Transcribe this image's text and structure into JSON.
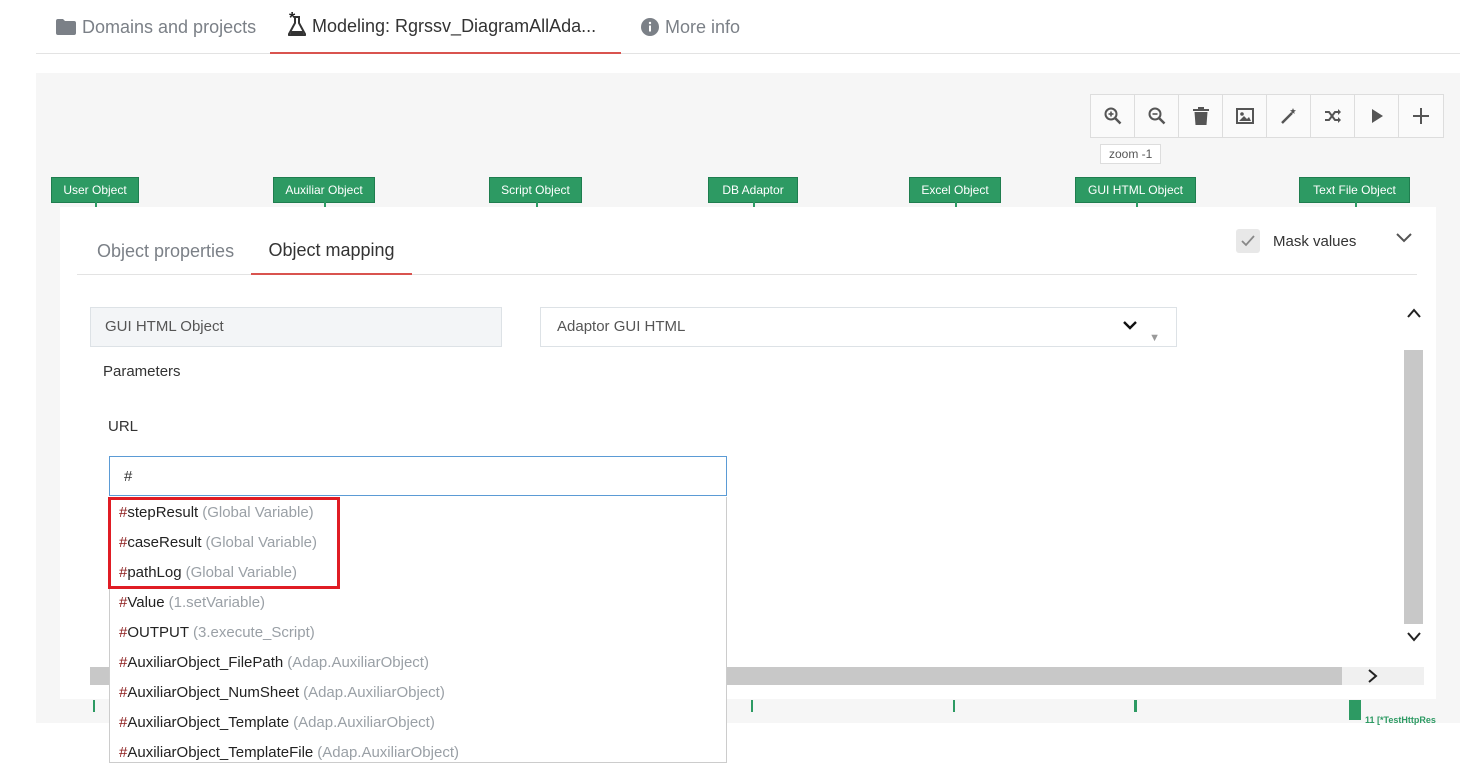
{
  "top_tabs": {
    "domains": "Domains and projects",
    "modeling_marker": "*",
    "modeling": "Modeling: Rgrssv_DiagramAllAda...",
    "more_info": "More info"
  },
  "toolbar": {
    "zoom_label": "zoom -1",
    "icons": [
      "zoom-in-icon",
      "zoom-out-icon",
      "trash-icon",
      "image-icon",
      "magic-wand-icon",
      "shuffle-icon",
      "play-icon",
      "plus-icon"
    ]
  },
  "nodes": [
    "User Object",
    "Auxiliar Object",
    "Script Object",
    "DB Adaptor",
    "Excel Object",
    "GUI HTML Object",
    "Text File Object"
  ],
  "panel": {
    "tab_properties": "Object properties",
    "tab_mapping": "Object mapping",
    "mask_values": "Mask values",
    "object_name": "GUI HTML Object",
    "adaptor": "Adaptor GUI HTML",
    "parameters": "Parameters",
    "url_label": "URL",
    "url_value": "#"
  },
  "bottom_text": "11 [*TestHttpRes",
  "autocomplete": [
    {
      "name": "stepResult",
      "source": "(Global Variable)"
    },
    {
      "name": "caseResult",
      "source": "(Global Variable)"
    },
    {
      "name": "pathLog",
      "source": "(Global Variable)"
    },
    {
      "name": "Value",
      "source": "(1.setVariable)"
    },
    {
      "name": "OUTPUT",
      "source": "(3.execute_Script)"
    },
    {
      "name": "AuxiliarObject_FilePath",
      "source": "(Adap.AuxiliarObject)"
    },
    {
      "name": "AuxiliarObject_NumSheet",
      "source": "(Adap.AuxiliarObject)"
    },
    {
      "name": "AuxiliarObject_Template",
      "source": "(Adap.AuxiliarObject)"
    },
    {
      "name": "AuxiliarObject_TemplateFile",
      "source": "(Adap.AuxiliarObject)"
    }
  ],
  "colors": {
    "accent": "#d9534f",
    "node_green": "#2d9a63",
    "highlight": "#e01c24"
  }
}
